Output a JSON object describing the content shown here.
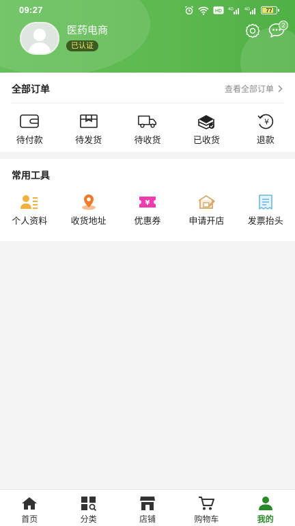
{
  "status_bar": {
    "time": "09:27",
    "battery": "77"
  },
  "profile": {
    "name": "医药电商",
    "badge": "已认证",
    "message_count": "2"
  },
  "orders": {
    "title": "全部订单",
    "view_all": "查看全部订单",
    "items": [
      {
        "label": "待付款",
        "icon": "wallet-icon"
      },
      {
        "label": "待发货",
        "icon": "box-icon"
      },
      {
        "label": "待收货",
        "icon": "truck-icon"
      },
      {
        "label": "已收货",
        "icon": "received-box-icon"
      },
      {
        "label": "退款",
        "icon": "refund-icon"
      }
    ]
  },
  "tools": {
    "title": "常用工具",
    "items": [
      {
        "label": "个人资料",
        "icon": "profile-card-icon"
      },
      {
        "label": "收货地址",
        "icon": "location-pin-icon"
      },
      {
        "label": "优惠券",
        "icon": "coupon-icon"
      },
      {
        "label": "申请开店",
        "icon": "shop-apply-icon"
      },
      {
        "label": "发票抬头",
        "icon": "invoice-icon"
      }
    ]
  },
  "bottom_nav": {
    "items": [
      {
        "label": "首页",
        "icon": "home-icon"
      },
      {
        "label": "分类",
        "icon": "category-icon"
      },
      {
        "label": "店铺",
        "icon": "store-icon"
      },
      {
        "label": "购物车",
        "icon": "cart-icon"
      },
      {
        "label": "我的",
        "icon": "user-icon",
        "active": true
      }
    ]
  },
  "colors": {
    "brand_green": "#5cb84f",
    "badge_bg": "#3c5b20",
    "badge_text": "#f2e36b",
    "active_nav": "#2a8a2a"
  }
}
